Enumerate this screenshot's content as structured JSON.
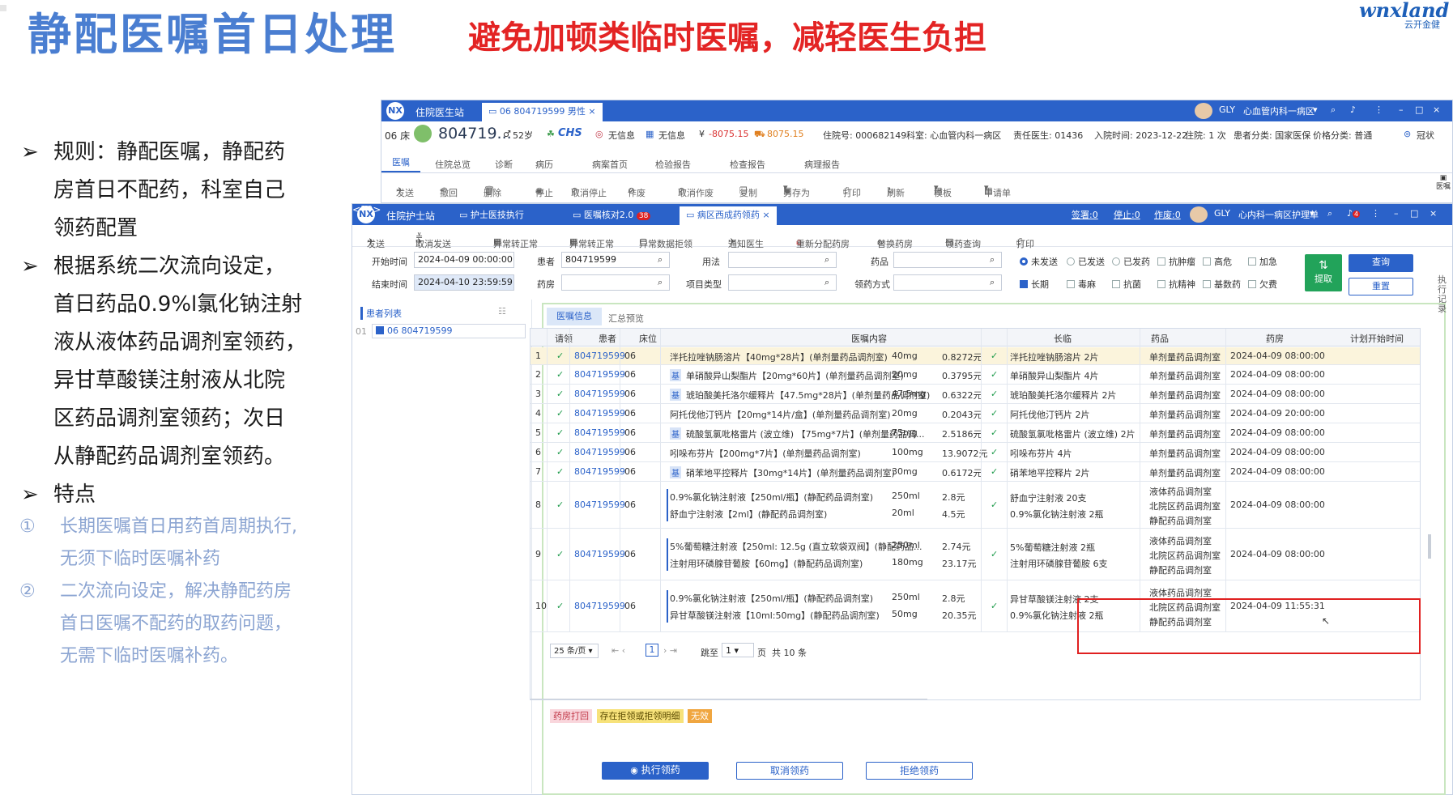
{
  "slide": {
    "title": "静配医嘱首日处理",
    "subtitle": "避免加顿类临时医嘱，减轻医生负担",
    "logo_text": "wnxland",
    "logo_sub": "云开金健",
    "bullet_mark": "➢",
    "bullets": [
      {
        "lines": [
          "规则：静配医嘱，静配药",
          "房首日不配药，科室自己",
          "领药配置"
        ]
      },
      {
        "lines": [
          "根据系统二次流向设定，",
          "首日药品0.9%l氯化钠注射",
          "液从液体药品调剂室领药，",
          "异甘草酸镁注射液从北院",
          "区药品调剂室领药；次日",
          "从静配药品调剂室领药。"
        ]
      },
      {
        "lines": [
          "特点"
        ]
      }
    ],
    "points": [
      {
        "num": "①",
        "lines": [
          "长期医嘱首日用药首周期执行,",
          "无须下临时医嘱补药"
        ]
      },
      {
        "num": "②",
        "lines": [
          "二次流向设定，解决静配药房",
          "首日医嘱不配药的取药问题，",
          "无需下临时医嘱补药。"
        ]
      }
    ]
  },
  "doctor_window": {
    "logo": "NX",
    "app_title": "住院医生站",
    "tab": "06 804719599 男性",
    "user": "GLY",
    "dept": "心血管内科一病区",
    "info": {
      "bed": "06 床",
      "patient_id": "804719...",
      "age": "52岁",
      "chs": "CHS",
      "no_info1": "无信息",
      "no_info2": "无信息",
      "balance1": "-8075.15",
      "balance2": "8075.15",
      "admission_no": "住院号: 000682149",
      "department": "科室: 心血管内科一病区",
      "doctor": "责任医生: 01436",
      "admit_time": "入院时间: 2023-12-22",
      "times": "住院: 1 次",
      "patient_type": "患者分类: 国家医保",
      "price_type": "价格分类: 普通",
      "crown": "冠状"
    },
    "menu": [
      "医嘱",
      "住院总览",
      "诊断",
      "病历",
      "病案首页",
      "检验报告",
      "检查报告",
      "病理报告"
    ],
    "tools": [
      "发送",
      "撤回",
      "删除",
      "停止",
      "取消停止",
      "作废",
      "取消作废",
      "复制",
      "另存为",
      "打印",
      "刷新",
      "模板",
      "申请单"
    ]
  },
  "nurse_window": {
    "logo": "NX",
    "app_title": "住院护士站",
    "tabs": [
      "护士医技执行",
      "医嘱核对2.0",
      "病区西成药领药"
    ],
    "badge": "38",
    "counters": [
      "签署:0",
      "停止:0",
      "作废:0"
    ],
    "user": "GLY",
    "dept": "心内科一病区护理单",
    "bell_badge": "4",
    "toolbar": [
      "发送",
      "取消发送",
      "异常转正常",
      "异常转正常",
      "异常数据拒领",
      "通知医生",
      "重新分配药房",
      "替换药房",
      "领药查询",
      "打印"
    ],
    "side_right": "执行记录",
    "filters": {
      "start_label": "开始时间",
      "start_value": "2024-04-09 00:00:00",
      "end_label": "结束时间",
      "end_value": "2024-04-10 23:59:59",
      "patient_label": "患者",
      "patient_value": "804719599",
      "pharmacy_label": "药房",
      "usage_label": "用法",
      "item_type_label": "项目类型",
      "drug_label": "药品",
      "receive_label": "领药方式",
      "radios": [
        "未发送",
        "已发送",
        "已发药"
      ],
      "checks_row1": [
        "抗肿瘤",
        "高危",
        "加急"
      ],
      "checks_row2": [
        "长期",
        "毒麻",
        "抗菌",
        "抗精神",
        "基数药",
        "欠费"
      ],
      "extract": "提取",
      "query": "查询",
      "reset": "重置"
    },
    "patient_list": {
      "title": "患者列表",
      "row_no": "01",
      "patient": "06 804719599"
    },
    "tabs_inner": [
      "医嘱信息",
      "汇总预览"
    ],
    "columns": [
      "请领",
      "患者",
      "床位",
      "医嘱内容",
      "长临",
      "药品",
      "药房",
      "计划开始时间"
    ],
    "rows": [
      {
        "no": "1",
        "patient": "804719599",
        "bed": "06",
        "orders": [
          {
            "text": "泮托拉唑钠肠溶片【40mg*28片】(单剂量药品调剂室)",
            "dose": "40mg",
            "price": "0.8272元"
          }
        ],
        "drug": [
          "泮托拉唑钠肠溶片 2片"
        ],
        "pharmacy": [
          "单剂量药品调剂室"
        ],
        "time": "2024-04-09 08:00:00"
      },
      {
        "no": "2",
        "patient": "804719599",
        "bed": "06",
        "tag": "基",
        "orders": [
          {
            "text": "单硝酸异山梨酯片【20mg*60片】(单剂量药品调剂室)",
            "dose": "20mg",
            "price": "0.3795元"
          }
        ],
        "drug": [
          "单硝酸异山梨酯片 4片"
        ],
        "pharmacy": [
          "单剂量药品调剂室"
        ],
        "time": "2024-04-09 08:00:00"
      },
      {
        "no": "3",
        "patient": "804719599",
        "bed": "06",
        "tag": "基",
        "orders": [
          {
            "text": "琥珀酸美托洛尔缓释片【47.5mg*28片】(单剂量药品调剂室)",
            "dose": "47.5mg",
            "price": "0.6322元"
          }
        ],
        "drug": [
          "琥珀酸美托洛尔缓释片 2片"
        ],
        "pharmacy": [
          "单剂量药品调剂室"
        ],
        "time": "2024-04-09 08:00:00"
      },
      {
        "no": "4",
        "patient": "804719599",
        "bed": "06",
        "orders": [
          {
            "text": "阿托伐他汀钙片【20mg*14片/盒】(单剂量药品调剂室)",
            "dose": "20mg",
            "price": "0.2043元"
          }
        ],
        "drug": [
          "阿托伐他汀钙片 2片"
        ],
        "pharmacy": [
          "单剂量药品调剂室"
        ],
        "time": "2024-04-09 20:00:00"
      },
      {
        "no": "5",
        "patient": "804719599",
        "bed": "06",
        "tag": "基",
        "orders": [
          {
            "text": "硫酸氢氯吡格雷片 (波立维) 【75mg*7片】(单剂量药品调...",
            "dose": "75mg",
            "price": "2.5186元"
          }
        ],
        "drug": [
          "硫酸氢氯吡格雷片 (波立维) 2片"
        ],
        "pharmacy": [
          "单剂量药品调剂室"
        ],
        "time": "2024-04-09 08:00:00"
      },
      {
        "no": "6",
        "patient": "804719599",
        "bed": "06",
        "orders": [
          {
            "text": "吲哚布芬片【200mg*7片】(单剂量药品调剂室)",
            "dose": "100mg",
            "price": "13.9072元"
          }
        ],
        "drug": [
          "吲哚布芬片 4片"
        ],
        "pharmacy": [
          "单剂量药品调剂室"
        ],
        "time": "2024-04-09 08:00:00"
      },
      {
        "no": "7",
        "patient": "804719599",
        "bed": "06",
        "tag": "基",
        "orders": [
          {
            "text": "硝苯地平控释片【30mg*14片】(单剂量药品调剂室)",
            "dose": "30mg",
            "price": "0.6172元"
          }
        ],
        "drug": [
          "硝苯地平控释片 2片"
        ],
        "pharmacy": [
          "单剂量药品调剂室"
        ],
        "time": "2024-04-09 08:00:00"
      },
      {
        "no": "8",
        "patient": "804719599",
        "bed": "06",
        "orders": [
          {
            "text": "0.9%氯化钠注射液【250ml/瓶】(静配药品调剂室)",
            "dose": "250ml",
            "price": "2.8元"
          },
          {
            "text": "舒血宁注射液【2ml】(静配药品调剂室)",
            "dose": "20ml",
            "price": "4.5元"
          }
        ],
        "drug": [
          "舒血宁注射液 20支",
          "0.9%氯化钠注射液 2瓶"
        ],
        "pharmacy": [
          "液体药品调剂室",
          "北院区药品调剂室",
          "静配药品调剂室"
        ],
        "time": "2024-04-09 08:00:00"
      },
      {
        "no": "9",
        "patient": "804719599",
        "bed": "06",
        "orders": [
          {
            "text": "5%葡萄糖注射液【250ml: 12.5g (直立软袋双阀】(静配药品...",
            "dose": "250ml",
            "price": "2.74元"
          },
          {
            "text": "注射用环磷腺苷葡胺【60mg】(静配药品调剂室)",
            "dose": "180mg",
            "price": "23.17元"
          }
        ],
        "drug": [
          "5%葡萄糖注射液 2瓶",
          "注射用环磷腺苷葡胺 6支"
        ],
        "pharmacy": [
          "液体药品调剂室",
          "北院区药品调剂室",
          "静配药品调剂室"
        ],
        "time": "2024-04-09 08:00:00"
      },
      {
        "no": "10",
        "patient": "804719599",
        "bed": "06",
        "orders": [
          {
            "text": "0.9%氯化钠注射液【250ml/瓶】(静配药品调剂室)",
            "dose": "250ml",
            "price": "2.8元"
          },
          {
            "text": "异甘草酸镁注射液【10ml:50mg】(静配药品调剂室)",
            "dose": "50mg",
            "price": "20.35元"
          }
        ],
        "drug": [
          "异甘草酸镁注射液 2支",
          "0.9%氯化钠注射液 2瓶"
        ],
        "pharmacy": [
          "液体药品调剂室",
          "北院区药品调剂室",
          "静配药品调剂室"
        ],
        "time": "2024-04-09 11:55:31"
      }
    ],
    "legend": [
      {
        "label": "药房打回",
        "bg": "#f9d6dc",
        "fg": "#c23a4a"
      },
      {
        "label": "存在拒领或拒领明细",
        "bg": "#f7e27a",
        "fg": "#5a4a00"
      },
      {
        "label": "无效",
        "bg": "#f0a640",
        "fg": "#ffffff"
      }
    ],
    "pager": {
      "per_page": "25 条/页",
      "page": "1",
      "goto_label": "跳至",
      "goto_value": "1",
      "page_unit": "页",
      "total": "共 10 条"
    },
    "buttons": [
      "执行领药",
      "取消领药",
      "拒绝领药"
    ]
  },
  "colors": {
    "primary": "#2b62c9",
    "title_blue": "#4a7ed1",
    "red": "#e32424",
    "green": "#1e9b4b"
  }
}
